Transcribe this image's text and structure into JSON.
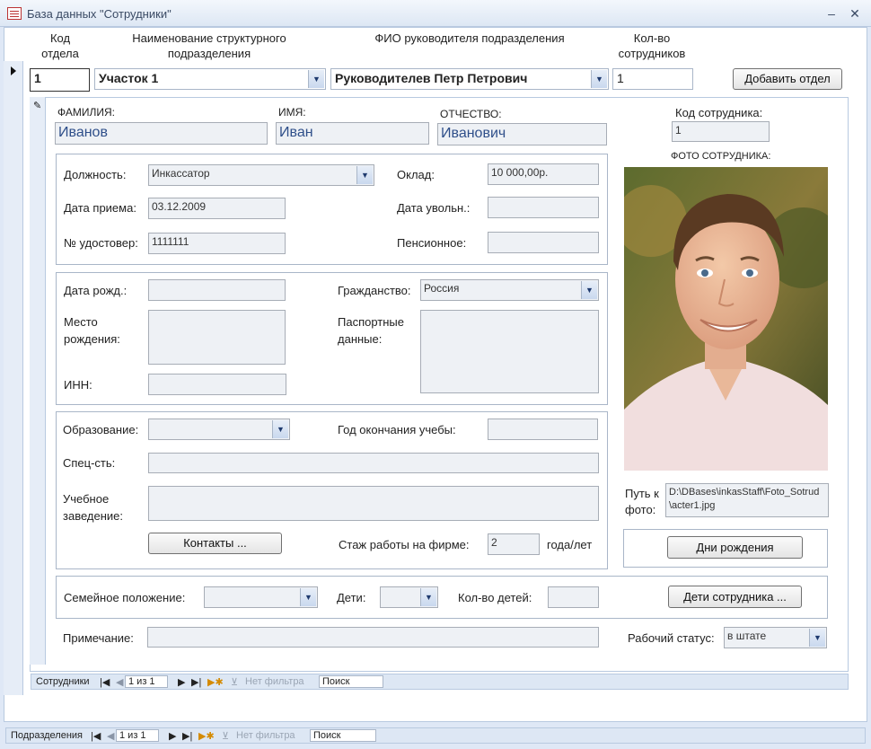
{
  "window": {
    "title": "База данных \"Сотрудники\"",
    "minimize": "–",
    "close": "✕"
  },
  "header": {
    "col_code": "Код\nотдела",
    "col_name": "Наименование структурного\nподразделения",
    "col_head": "ФИО руководителя подразделения",
    "col_count": "Кол-во\nсотрудников"
  },
  "dept": {
    "code": "1",
    "name": "Участок 1",
    "head": "Руководителев Петр Петрович",
    "count": "1",
    "add_button": "Добавить отдел"
  },
  "employee": {
    "lastname_label": "ФАМИЛИЯ:",
    "lastname": "Иванов",
    "firstname_label": "ИМЯ:",
    "firstname": "Иван",
    "patronymic_label": "ОТЧЕСТВО:",
    "patronymic": "Иванович",
    "code_label": "Код сотрудника:",
    "code": "1",
    "photo_label": "ФОТО  СОТРУДНИКА:",
    "position_label": "Должность:",
    "position": "Инкассатор",
    "salary_label": "Оклад:",
    "salary": "10 000,00р.",
    "hire_label": "Дата приема:",
    "hire": "03.12.2009",
    "fire_label": "Дата увольн.:",
    "fire": "",
    "id_label": "№ удостовер:",
    "id": "1111111",
    "pension_label": "Пенсионное:",
    "pension": "",
    "birth_label": "Дата рожд.:",
    "birth": "",
    "citizenship_label": "Гражданство:",
    "citizenship": "Россия",
    "birthplace_label": "Место\nрождения:",
    "passport_label": "Паспортные\nданные:",
    "inn_label": "ИНН:",
    "education_label": "Образование:",
    "grad_year_label": "Год окончания учебы:",
    "specialty_label": "Спец-сть:",
    "school_label": "Учебное\nзаведение:",
    "contacts_button": "Контакты ...",
    "tenure_label": "Стаж работы на фирме:",
    "tenure": "2",
    "tenure_unit": "года/лет",
    "photo_path_label": "Путь к\nфото:",
    "photo_path": "D:\\DBases\\inkasStaff\\Foto_Sotrud\\acter1.jpg",
    "birthdays_button": "Дни рождения",
    "marital_label": "Семейное положение:",
    "children_label": "Дети:",
    "children_count_label": "Кол-во детей:",
    "children_button": "Дети сотрудника ...",
    "note_label": "Примечание:",
    "status_label": "Рабочий статус:",
    "status": "в штате"
  },
  "nav_inner": {
    "label": "Сотрудники",
    "record": "1 из 1",
    "filter": "Нет фильтра",
    "search": "Поиск"
  },
  "nav_outer": {
    "label": "Подразделения",
    "record": "1 из 1",
    "filter": "Нет фильтра",
    "search": "Поиск"
  },
  "colors": {
    "accent": "#2f4f8a",
    "frame": "#b8c9e0",
    "field_bg": "#eef1f5"
  }
}
